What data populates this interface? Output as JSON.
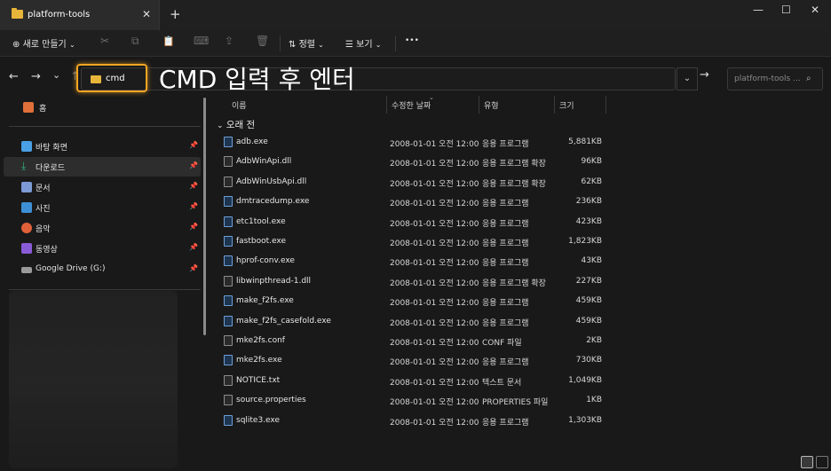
{
  "tab": {
    "title": "platform-tools",
    "close": "✕",
    "new": "+"
  },
  "window_controls": {
    "minimize": "—",
    "maximize": "☐",
    "close": "✕"
  },
  "toolbar": {
    "new_label": "새로 만들기",
    "sort_label": "정렬",
    "view_label": "보기",
    "more": "•••",
    "cut": "✂",
    "copy": "⧉",
    "paste": "📋",
    "rename": "⌨",
    "share": "⇪",
    "delete": "🗑"
  },
  "nav": {
    "back": "←",
    "forward": "→",
    "recent": "⌄",
    "up": "↑",
    "go": "→"
  },
  "address": {
    "value": "cmd"
  },
  "annotation": "CMD 입력 후 엔터",
  "search": {
    "placeholder": "platform-tools ..."
  },
  "sidebar": {
    "home": "홈",
    "items": [
      {
        "label": "바탕 화면",
        "color": "#4aa0e6"
      },
      {
        "label": "다운로드",
        "color": "#34b27a"
      },
      {
        "label": "문서",
        "color": "#7c9bd6"
      },
      {
        "label": "사진",
        "color": "#3e90d6"
      },
      {
        "label": "음악",
        "color": "#e0603a"
      },
      {
        "label": "동영상",
        "color": "#8a5bd6"
      },
      {
        "label": "Google Drive (G:)",
        "color": "#9a9a9a"
      }
    ]
  },
  "columns": {
    "name": "이름",
    "date": "수정한 날짜",
    "type": "유형",
    "size": "크기"
  },
  "group": "오래 전",
  "files": [
    {
      "name": "adb.exe",
      "date": "2008-01-01 오전 12:00",
      "type": "응용 프로그램",
      "size": "5,881KB",
      "kind": "exe"
    },
    {
      "name": "AdbWinApi.dll",
      "date": "2008-01-01 오전 12:00",
      "type": "응용 프로그램 확장",
      "size": "96KB",
      "kind": "dll"
    },
    {
      "name": "AdbWinUsbApi.dll",
      "date": "2008-01-01 오전 12:00",
      "type": "응용 프로그램 확장",
      "size": "62KB",
      "kind": "dll"
    },
    {
      "name": "dmtracedump.exe",
      "date": "2008-01-01 오전 12:00",
      "type": "응용 프로그램",
      "size": "236KB",
      "kind": "exe"
    },
    {
      "name": "etc1tool.exe",
      "date": "2008-01-01 오전 12:00",
      "type": "응용 프로그램",
      "size": "423KB",
      "kind": "exe"
    },
    {
      "name": "fastboot.exe",
      "date": "2008-01-01 오전 12:00",
      "type": "응용 프로그램",
      "size": "1,823KB",
      "kind": "exe"
    },
    {
      "name": "hprof-conv.exe",
      "date": "2008-01-01 오전 12:00",
      "type": "응용 프로그램",
      "size": "43KB",
      "kind": "exe"
    },
    {
      "name": "libwinpthread-1.dll",
      "date": "2008-01-01 오전 12:00",
      "type": "응용 프로그램 확장",
      "size": "227KB",
      "kind": "dll"
    },
    {
      "name": "make_f2fs.exe",
      "date": "2008-01-01 오전 12:00",
      "type": "응용 프로그램",
      "size": "459KB",
      "kind": "exe"
    },
    {
      "name": "make_f2fs_casefold.exe",
      "date": "2008-01-01 오전 12:00",
      "type": "응용 프로그램",
      "size": "459KB",
      "kind": "exe"
    },
    {
      "name": "mke2fs.conf",
      "date": "2008-01-01 오전 12:00",
      "type": "CONF 파일",
      "size": "2KB",
      "kind": "file"
    },
    {
      "name": "mke2fs.exe",
      "date": "2008-01-01 오전 12:00",
      "type": "응용 프로그램",
      "size": "730KB",
      "kind": "exe"
    },
    {
      "name": "NOTICE.txt",
      "date": "2008-01-01 오전 12:00",
      "type": "텍스트 문서",
      "size": "1,049KB",
      "kind": "file"
    },
    {
      "name": "source.properties",
      "date": "2008-01-01 오전 12:00",
      "type": "PROPERTIES 파일",
      "size": "1KB",
      "kind": "file"
    },
    {
      "name": "sqlite3.exe",
      "date": "2008-01-01 오전 12:00",
      "type": "응용 프로그램",
      "size": "1,303KB",
      "kind": "exe"
    }
  ],
  "colors": {
    "highlight": "#f5a623",
    "folder": "#e8b53b"
  }
}
